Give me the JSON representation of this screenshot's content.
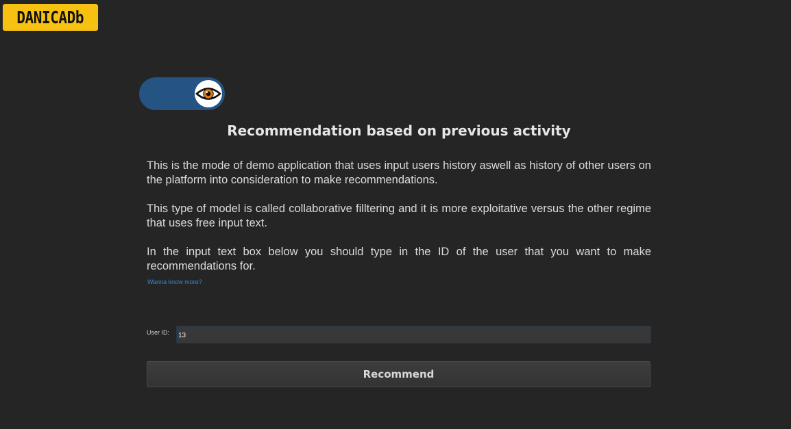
{
  "logo": {
    "text": "DANICADb",
    "color": "#f7c112"
  },
  "mode_toggle": {
    "icon": "eye-icon",
    "state": "on",
    "color": "#255482"
  },
  "main": {
    "title": "Recommendation based on previous activity",
    "paragraphs": [
      "This is the mode of demo application that uses input users history aswell as history of other users on the platform into consideration to make recommendations.",
      "This type of model is called collaborative filltering and it is more exploitative versus the other regime that uses free input text.",
      "In the input text box below you should type in the ID of the user that you want to make recommendations for."
    ],
    "more_link": "Wanna know more?"
  },
  "form": {
    "user_id_label": "User ID:",
    "user_id_value": "13",
    "recommend_label": "Recommend"
  }
}
